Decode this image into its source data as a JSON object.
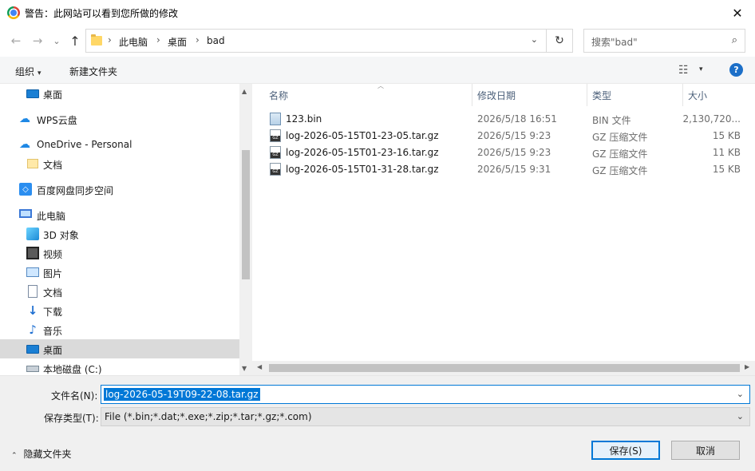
{
  "window": {
    "title": "警告：此网站可以看到您所做的修改",
    "close_glyph": "✕"
  },
  "nav": {
    "back_glyph": "←",
    "forward_glyph": "→",
    "dropdown_glyph": "⌄",
    "up_glyph": "↑",
    "breadcrumb": [
      "此电脑",
      "桌面",
      "bad"
    ],
    "sep_glyph": "›",
    "address_dropdown_glyph": "⌄",
    "refresh_glyph": "↻",
    "search_placeholder": "搜索\"bad\"",
    "search_icon_glyph": "⌕"
  },
  "toolbar": {
    "organize_label": "组织",
    "new_folder_label": "新建文件夹",
    "caret_glyph": "▾",
    "view_glyph": "☷",
    "help_glyph": "?"
  },
  "sidebar": {
    "items": [
      {
        "label": "桌面",
        "icon": "desktop-icon"
      },
      {
        "label": "WPS云盘",
        "icon": "cloud-icon"
      },
      {
        "label": "OneDrive - Personal",
        "icon": "cloud-icon"
      },
      {
        "label": "文档",
        "icon": "folder-icon"
      },
      {
        "label": "百度网盘同步空间",
        "icon": "baidu-icon"
      },
      {
        "label": "此电脑",
        "icon": "computer-icon"
      },
      {
        "label": "3D 对象",
        "icon": "3d-objects-icon"
      },
      {
        "label": "视频",
        "icon": "video-icon"
      },
      {
        "label": "图片",
        "icon": "pictures-icon"
      },
      {
        "label": "文档",
        "icon": "documents-icon"
      },
      {
        "label": "下载",
        "icon": "download-icon"
      },
      {
        "label": "音乐",
        "icon": "music-icon"
      },
      {
        "label": "桌面",
        "icon": "desktop-icon",
        "selected": true
      },
      {
        "label": "本地磁盘 (C:)",
        "icon": "drive-icon"
      }
    ],
    "glyphs": {
      "cloud": "☁",
      "down": "↓",
      "music": "♪",
      "baidu": "◇"
    }
  },
  "columns": {
    "name": "名称",
    "date": "修改日期",
    "type": "类型",
    "size": "大小",
    "sort_glyph": "︿"
  },
  "files": [
    {
      "name": "123.bin",
      "date": "2026/5/18 16:51",
      "type": "BIN 文件",
      "size": "2,130,720...",
      "icon": "bin-file-icon"
    },
    {
      "name": "log-2026-05-15T01-23-05.tar.gz",
      "date": "2026/5/15 9:23",
      "type": "GZ 压缩文件",
      "size": "15 KB",
      "icon": "gz-file-icon"
    },
    {
      "name": "log-2026-05-15T01-23-16.tar.gz",
      "date": "2026/5/15 9:23",
      "type": "GZ 压缩文件",
      "size": "11 KB",
      "icon": "gz-file-icon"
    },
    {
      "name": "log-2026-05-15T01-31-28.tar.gz",
      "date": "2026/5/15 9:31",
      "type": "GZ 压缩文件",
      "size": "15 KB",
      "icon": "gz-file-icon"
    }
  ],
  "scroll_glyphs": {
    "up": "▲",
    "down": "▼",
    "left": "◀",
    "right": "▶"
  },
  "footer": {
    "filename_label": "文件名(N):",
    "filename_value": "log-2026-05-19T09-22-08.tar.gz",
    "filetype_label": "保存类型(T):",
    "filetype_value": "File (*.bin;*.dat;*.exe;*.zip;*.tar;*.gz;*.com)",
    "dropdown_glyph": "⌄",
    "hide_folders_label": "隐藏文件夹",
    "hide_caret_glyph": "⌃",
    "save_label": "保存(S)",
    "cancel_label": "取消"
  }
}
